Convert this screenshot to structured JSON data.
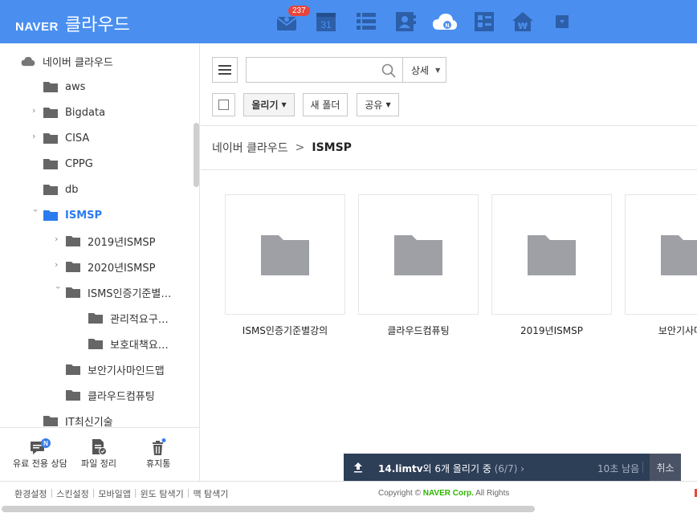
{
  "header": {
    "brand": "NAVER",
    "product": "클라우드",
    "mail_badge": "237",
    "calendar_day": "31",
    "apps": [
      "mail-icon",
      "calendar-icon",
      "list-icon",
      "contacts-icon",
      "cloud-icon",
      "memo-icon",
      "household-ledger-icon",
      "more-dropdown-icon"
    ],
    "colors": {
      "bar": "#4a8ff0",
      "active": "#2b7bf0",
      "badge": "#e8453c"
    }
  },
  "sidebar": {
    "root": "네이버 클라우드",
    "items": [
      {
        "label": "aws"
      },
      {
        "label": "Bigdata"
      },
      {
        "label": "CISA"
      },
      {
        "label": "CPPG"
      },
      {
        "label": "db"
      },
      {
        "label": "ISMSP"
      },
      {
        "label": "2019년ISMSP"
      },
      {
        "label": "2020년ISMSP"
      },
      {
        "label": "ISMS인증기준별…"
      },
      {
        "label": "관리적요구…"
      },
      {
        "label": "보호대책요…"
      },
      {
        "label": "보안기사마인드맵"
      },
      {
        "label": "클라우드컴퓨팅"
      },
      {
        "label": "IT최신기술"
      }
    ],
    "actions": [
      {
        "label": "유료 전용 상담",
        "badge": "N"
      },
      {
        "label": "파일 정리"
      },
      {
        "label": "휴지통"
      }
    ]
  },
  "toolbar": {
    "search_placeholder": "",
    "detail_label": "상세",
    "upload_label": "올리기",
    "new_folder_label": "새 폴더",
    "share_label": "공유"
  },
  "breadcrumb": {
    "root": "네이버 클라우드",
    "separator": ">",
    "current": "ISMSP"
  },
  "folders": [
    {
      "name": "ISMS인증기준별강의"
    },
    {
      "name": "클라우드컴퓨팅"
    },
    {
      "name": "2019년ISMSP"
    },
    {
      "name": "보안기사마인"
    }
  ],
  "upload": {
    "file": "14.limtv",
    "message": "외 6개 올리기 중",
    "progress": "(6/7)",
    "remaining": "10초 남음",
    "cancel": "취소"
  },
  "footer": {
    "links": [
      "환경설정",
      "스킨설정",
      "모바일앱",
      "윈도 탐색기",
      "맥 탐색기"
    ],
    "copyright_prefix": "Copyright ©",
    "company": "NAVER Corp.",
    "rights": "All Rights"
  }
}
